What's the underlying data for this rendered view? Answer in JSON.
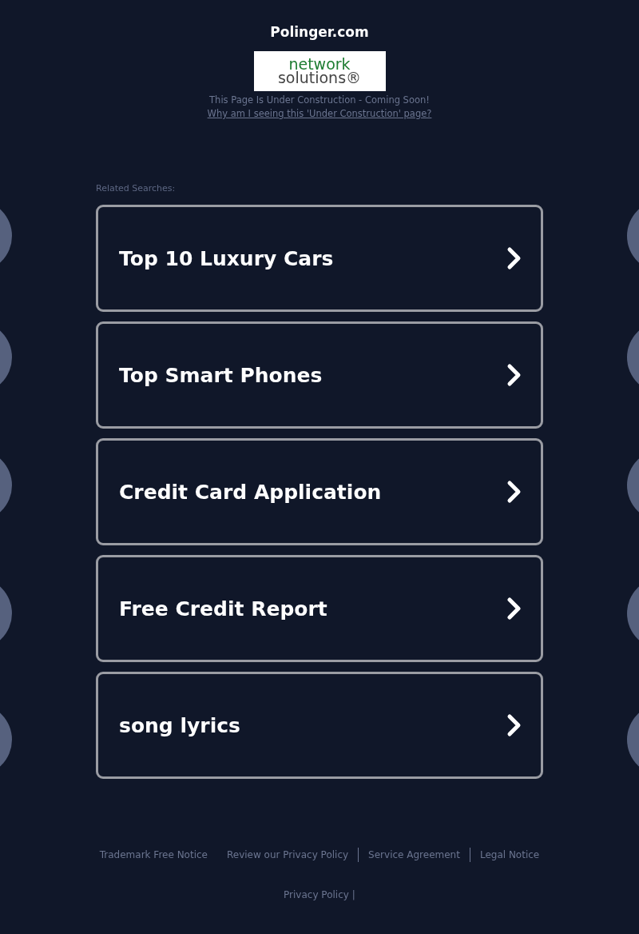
{
  "site_title": "Polinger.com",
  "logo": {
    "line_1": "network",
    "line_2": "solutions®"
  },
  "notice": "This Page Is Under Construction - Coming Soon!",
  "notice_link": "Why am I seeing this 'Under Construction' page?",
  "related_label": "Related Searches:",
  "searches": [
    {
      "label": "Top 10 Luxury Cars"
    },
    {
      "label": "Top Smart Phones"
    },
    {
      "label": "Credit Card Application"
    },
    {
      "label": "Free Credit Report"
    },
    {
      "label": "song lyrics"
    }
  ],
  "footer_links": [
    {
      "label": "Trademark Free Notice",
      "divider_after": false
    },
    {
      "label": "Review our Privacy Policy",
      "divider_after": true
    },
    {
      "label": "Service Agreement",
      "divider_after": true
    },
    {
      "label": "Legal Notice",
      "divider_after": false
    }
  ],
  "bottom_link": {
    "label": "Privacy Policy",
    "separator": "|"
  }
}
